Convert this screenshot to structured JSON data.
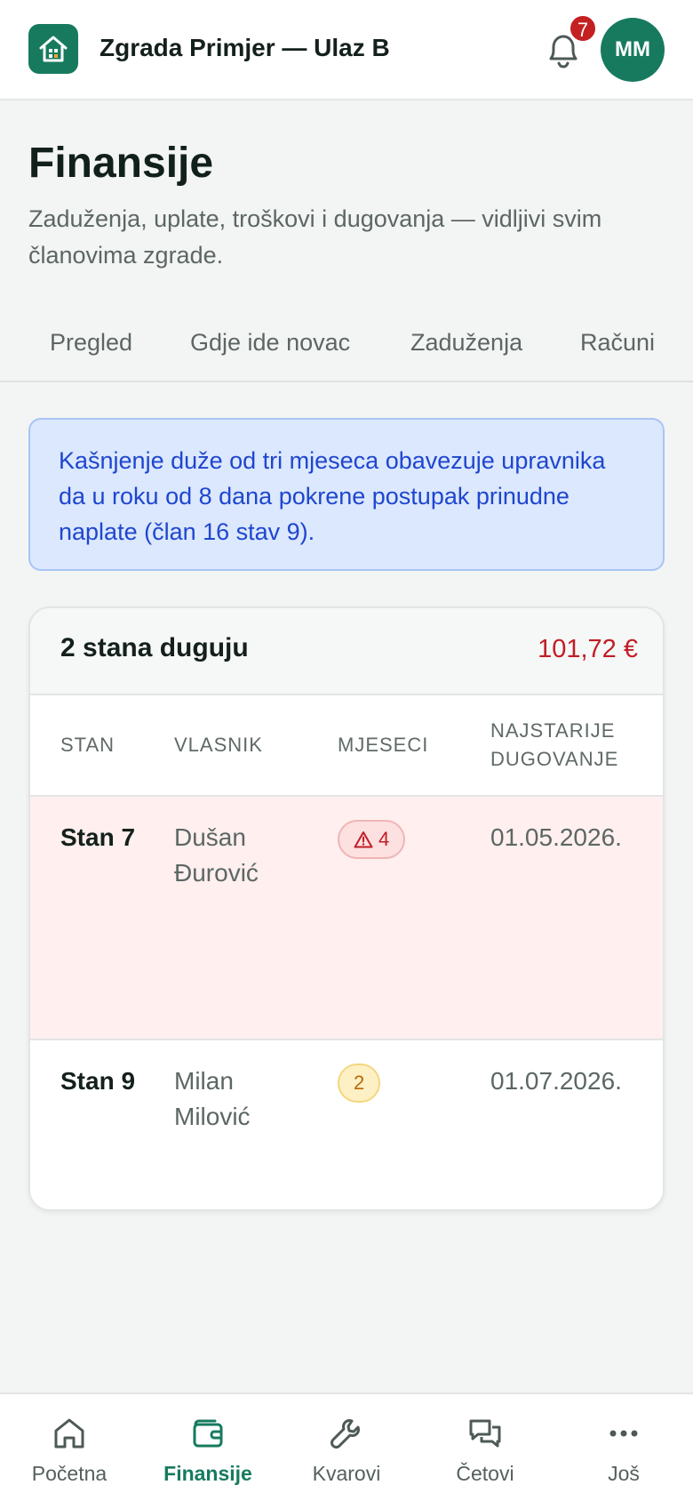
{
  "header": {
    "building_name": "Zgrada Primjer — Ulaz B",
    "notification_count": "7",
    "avatar_initials": "MM"
  },
  "page": {
    "title": "Finansije",
    "subtitle": "Zaduženja, uplate, troškovi i dugovanja — vidljivi svim članovima zgrade."
  },
  "tabs": [
    {
      "label": "Pregled"
    },
    {
      "label": "Gdje ide novac"
    },
    {
      "label": "Zaduženja"
    },
    {
      "label": "Računi"
    }
  ],
  "notice": {
    "text": "Kašnjenje duže od tri mjeseca obavezuje upravnika da u roku od 8 dana pokrene postupak prinudne naplate (član 16 stav 9)."
  },
  "debts": {
    "title": "2 stana duguju",
    "total": "101,72 €",
    "columns": {
      "unit": "STAN",
      "owner": "VLASNIK",
      "months": "MJESECI",
      "oldest": "NAJSTARIJE DUGOVANJE"
    },
    "rows": [
      {
        "unit": "Stan 7",
        "owner": "Dušan Đurović",
        "months": "4",
        "oldest": "01.05.2026.",
        "severity": "danger"
      },
      {
        "unit": "Stan 9",
        "owner": "Milan Milović",
        "months": "2",
        "oldest": "01.07.2026.",
        "severity": "warning"
      }
    ]
  },
  "bottom_nav": [
    {
      "label": "Početna",
      "icon": "home-icon"
    },
    {
      "label": "Finansije",
      "icon": "wallet-icon",
      "active": true
    },
    {
      "label": "Kvarovi",
      "icon": "wrench-icon"
    },
    {
      "label": "Četovi",
      "icon": "chat-icon"
    },
    {
      "label": "Još",
      "icon": "more-icon"
    }
  ],
  "colors": {
    "brand": "#177a5f",
    "danger": "#c11d25",
    "info_bg": "#dbe8fd",
    "info_text": "#1f46cf"
  }
}
